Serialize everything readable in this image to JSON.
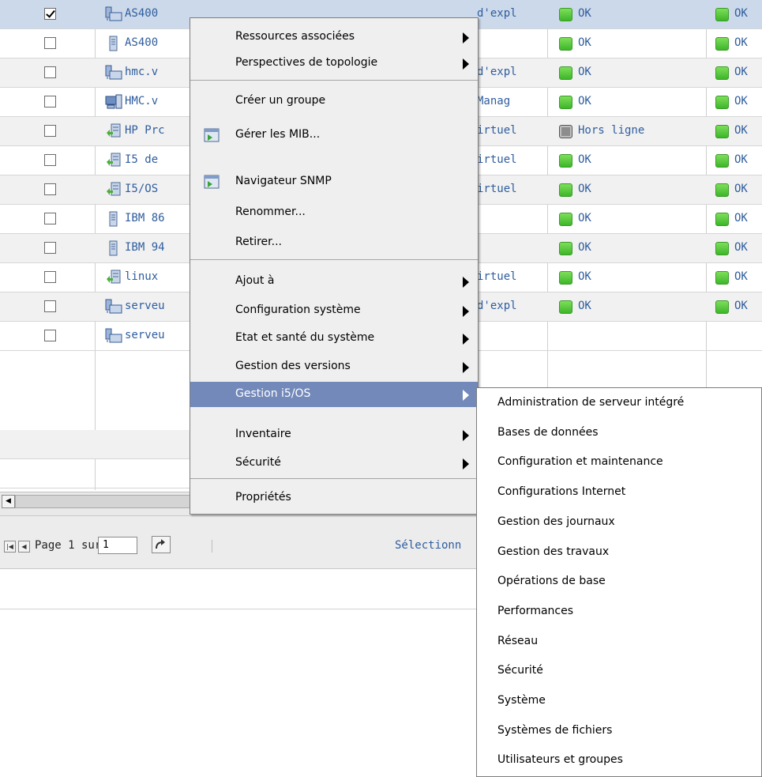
{
  "table": {
    "rows": [
      {
        "checked": true,
        "icon": "network-server-icon",
        "name": "AS400",
        "type": "d'expl",
        "status1": "OK",
        "status1_state": "ok",
        "status2": "OK",
        "selected": true
      },
      {
        "checked": false,
        "icon": "tower-server-icon",
        "name": "AS400",
        "type": "",
        "status1": "OK",
        "status1_state": "ok",
        "status2": "OK"
      },
      {
        "checked": false,
        "icon": "network-server-icon",
        "name": "hmc.v",
        "type": "d'expl",
        "status1": "OK",
        "status1_state": "ok",
        "status2": "OK"
      },
      {
        "checked": false,
        "icon": "console-icon",
        "name": "HMC.v",
        "type": "Manag",
        "status1": "OK",
        "status1_state": "ok",
        "status2": "OK"
      },
      {
        "checked": false,
        "icon": "virtual-server-icon",
        "name": "HP Prc",
        "type": "irtuel",
        "status1": "Hors ligne",
        "status1_state": "offline",
        "status2": "OK"
      },
      {
        "checked": false,
        "icon": "virtual-server-icon",
        "name": "I5 de",
        "type": "irtuel",
        "status1": "OK",
        "status1_state": "ok",
        "status2": "OK"
      },
      {
        "checked": false,
        "icon": "virtual-server-icon",
        "name": "I5/OS",
        "type": "irtuel",
        "status1": "OK",
        "status1_state": "ok",
        "status2": "OK"
      },
      {
        "checked": false,
        "icon": "tower-server-icon",
        "name": "IBM 86",
        "type": "",
        "status1": "OK",
        "status1_state": "ok",
        "status2": "OK"
      },
      {
        "checked": false,
        "icon": "tower-server-icon",
        "name": "IBM 94",
        "type": "",
        "status1": "OK",
        "status1_state": "ok",
        "status2": "OK"
      },
      {
        "checked": false,
        "icon": "virtual-server-icon",
        "name": "linux",
        "type": "irtuel",
        "status1": "OK",
        "status1_state": "ok",
        "status2": "OK"
      },
      {
        "checked": false,
        "icon": "network-server-icon",
        "name": "serveu",
        "type": "d'expl",
        "status1": "OK",
        "status1_state": "ok",
        "status2": "OK"
      },
      {
        "checked": false,
        "icon": "network-server-icon",
        "name": "serveu",
        "type": "",
        "status1": "",
        "status1_state": "none",
        "status2": ""
      }
    ]
  },
  "pager": {
    "page_text": "Page 1 sur 1",
    "page_input": "1",
    "select_text": "Sélectionn"
  },
  "context_menu": {
    "items": [
      {
        "label": "Ressources associées",
        "submenu": true
      },
      {
        "label": "Perspectives de topologie",
        "submenu": true
      },
      {
        "label": "Créer un groupe",
        "submenu": false
      },
      {
        "label": "Gérer les MIB...",
        "submenu": false,
        "icon": "mib-icon"
      },
      {
        "label": "Navigateur SNMP",
        "submenu": false,
        "icon": "snmp-browser-icon"
      },
      {
        "label": "Renommer...",
        "submenu": false
      },
      {
        "label": "Retirer...",
        "submenu": false
      },
      {
        "label": "Ajout à",
        "submenu": true
      },
      {
        "label": "Configuration système",
        "submenu": true
      },
      {
        "label": "Etat et santé du système",
        "submenu": true
      },
      {
        "label": "Gestion des versions",
        "submenu": true
      },
      {
        "label": "Gestion i5/OS",
        "submenu": true,
        "highlighted": true
      },
      {
        "label": "Inventaire",
        "submenu": true
      },
      {
        "label": "Sécurité",
        "submenu": true
      },
      {
        "label": "Propriétés",
        "submenu": false
      }
    ]
  },
  "submenu": {
    "items": [
      "Administration de serveur intégré",
      "Bases de données",
      "Configuration et maintenance",
      "Configurations Internet",
      "Gestion des journaux",
      "Gestion des travaux",
      "Opérations de base",
      "Performances",
      "Réseau",
      "Sécurité",
      "Système",
      "Systèmes de fichiers",
      "Utilisateurs et groupes"
    ]
  },
  "colors": {
    "menu_highlight": "#7389b9",
    "link_text": "#2f5d9e",
    "status_ok": "#3db62a",
    "row_selected": "#ccd9ea"
  }
}
